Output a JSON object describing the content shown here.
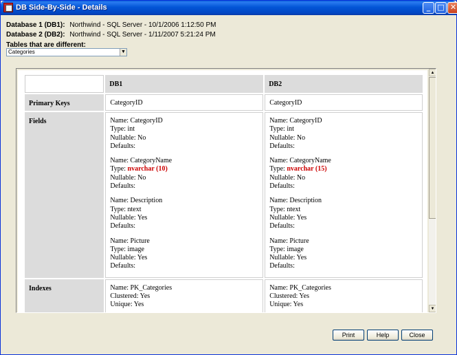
{
  "window": {
    "title": "DB Side-By-Side - Details"
  },
  "info": {
    "db1_label": "Database 1 (DB1):",
    "db1_value": "Northwind - SQL Server - 10/1/2006 1:12:50 PM",
    "db2_label": "Database 2 (DB2):",
    "db2_value": "Northwind - SQL Server - 1/11/2007 5:21:24 PM",
    "tables_label": "Tables that are different:",
    "tables_selected": "Categories"
  },
  "grid": {
    "col_db1": "DB1",
    "col_db2": "DB2",
    "row_pk": "Primary Keys",
    "row_fields": "Fields",
    "row_indexes": "Indexes",
    "db1": {
      "pk": "CategoryID",
      "fields": [
        {
          "name": "Name: CategoryID",
          "type_prefix": "Type: ",
          "type": "int",
          "nullable": "Nullable: No",
          "defaults": "Defaults:"
        },
        {
          "name": "Name: CategoryName",
          "type_prefix": "Type: ",
          "type": "nvarchar (10)",
          "nullable": "Nullable: No",
          "defaults": "Defaults:"
        },
        {
          "name": "Name: Description",
          "type_prefix": "Type: ",
          "type": "ntext",
          "nullable": "Nullable: Yes",
          "defaults": "Defaults:"
        },
        {
          "name": "Name: Picture",
          "type_prefix": "Type: ",
          "type": "image",
          "nullable": "Nullable: Yes",
          "defaults": "Defaults:"
        }
      ],
      "index": {
        "name": "Name: PK_Categories",
        "clustered": "Clustered: Yes",
        "unique": "Unique: Yes"
      }
    },
    "db2": {
      "pk": "CategoryID",
      "fields": [
        {
          "name": "Name: CategoryID",
          "type_prefix": "Type: ",
          "type": "int",
          "nullable": "Nullable: No",
          "defaults": "Defaults:"
        },
        {
          "name": "Name: CategoryName",
          "type_prefix": "Type: ",
          "type": "nvarchar (15)",
          "nullable": "Nullable: No",
          "defaults": "Defaults:"
        },
        {
          "name": "Name: Description",
          "type_prefix": "Type: ",
          "type": "ntext",
          "nullable": "Nullable: Yes",
          "defaults": "Defaults:"
        },
        {
          "name": "Name: Picture",
          "type_prefix": "Type: ",
          "type": "image",
          "nullable": "Nullable: Yes",
          "defaults": "Defaults:"
        }
      ],
      "index": {
        "name": "Name: PK_Categories",
        "clustered": "Clustered: Yes",
        "unique": "Unique: Yes"
      }
    }
  },
  "buttons": {
    "print": "Print",
    "help": "Help",
    "close": "Close"
  },
  "colors": {
    "diff": "#cc0000",
    "titlebar": "#0355d6"
  }
}
